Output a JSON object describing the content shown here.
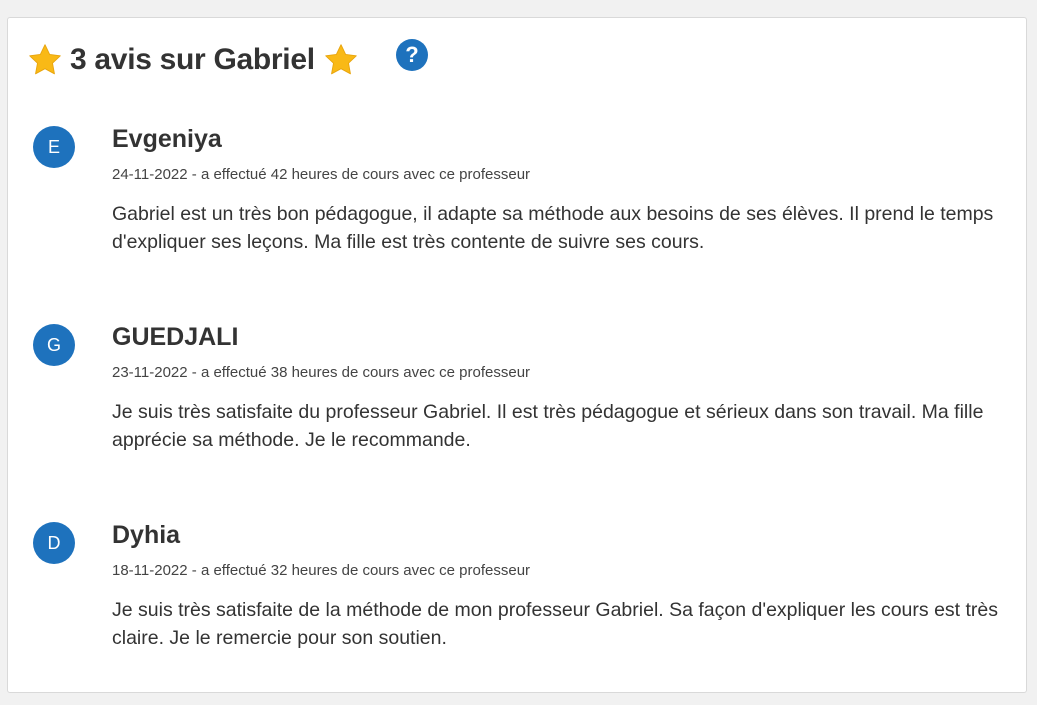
{
  "header": {
    "title": "3 avis sur Gabriel",
    "help_label": "?",
    "star_color": "#f9b916",
    "left_icon": "star-icon",
    "right_icon": "star-icon"
  },
  "colors": {
    "accent": "#1e72bd",
    "background": "#f1f1f1",
    "card": "#ffffff"
  },
  "reviews": [
    {
      "initial": "E",
      "name": "Evgeniya",
      "meta": "24-11-2022 - a effectué 42 heures de cours avec ce professeur",
      "text": "Gabriel est un très bon pédagogue, il adapte sa méthode aux besoins de ses élèves. Il prend le temps d'expliquer ses leçons. Ma fille est très contente de suivre ses cours."
    },
    {
      "initial": "G",
      "name": "GUEDJALI",
      "meta": "23-11-2022 - a effectué 38 heures de cours avec ce professeur",
      "text": "Je suis très satisfaite du professeur Gabriel. Il est très pédagogue et sérieux dans son travail. Ma fille apprécie sa méthode. Je le recommande."
    },
    {
      "initial": "D",
      "name": "Dyhia",
      "meta": "18-11-2022 - a effectué 32 heures de cours avec ce professeur",
      "text": "Je suis très satisfaite de la méthode de mon professeur Gabriel. Sa façon d'expliquer les cours est très claire. Je le remercie pour son soutien."
    }
  ]
}
